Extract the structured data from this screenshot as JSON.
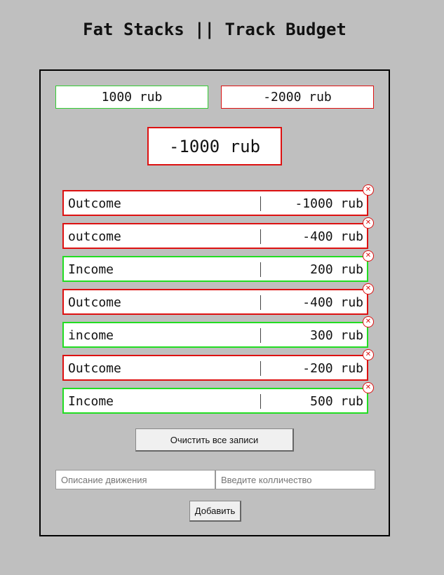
{
  "app": {
    "title": "Fat Stacks || Track Budget"
  },
  "summary": {
    "income": "1000 rub",
    "outcome": "-2000 rub",
    "balance": "-1000 rub"
  },
  "colors": {
    "income": "#22dd22",
    "outcome": "#dd1111",
    "background": "#bfbfbf"
  },
  "entries": [
    {
      "type": "outcome",
      "description": "Outcome",
      "amount": "-1000 rub"
    },
    {
      "type": "outcome",
      "description": "outcome",
      "amount": "-400 rub"
    },
    {
      "type": "income",
      "description": "Income",
      "amount": "200 rub"
    },
    {
      "type": "outcome",
      "description": "Outcome",
      "amount": "-400 rub"
    },
    {
      "type": "income",
      "description": "income",
      "amount": "300 rub"
    },
    {
      "type": "outcome",
      "description": "Outcome",
      "amount": "-200 rub"
    },
    {
      "type": "income",
      "description": "Income",
      "amount": "500 rub"
    }
  ],
  "delete_icon": "close-circle-icon",
  "actions": {
    "clear_label": "Очистить все записи",
    "add_label": "Добавить"
  },
  "form": {
    "description_placeholder": "Описание движения",
    "quantity_placeholder": "Введите колличество"
  }
}
